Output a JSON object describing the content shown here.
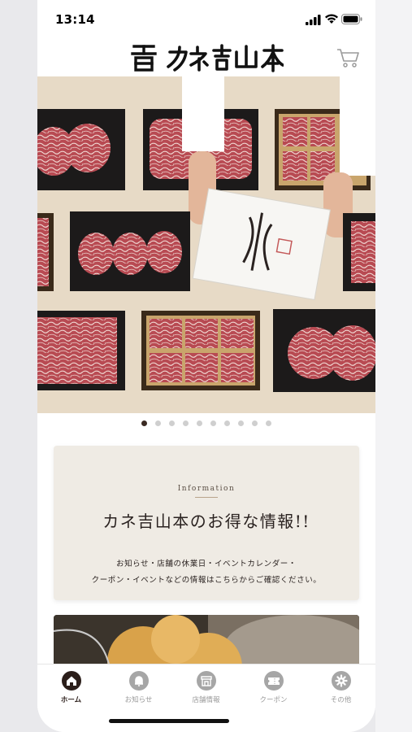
{
  "status_bar": {
    "time": "13:14"
  },
  "header": {
    "logo_text": "カネ吉山本",
    "cart_icon": "cart-icon"
  },
  "carousel": {
    "slide_count": 10,
    "active_index": 0
  },
  "info_card": {
    "label": "Information",
    "title": "カネ吉山本のお得な情報!!",
    "line1": "お知らせ・店舗の休業日・イベントカレンダー・",
    "line2": "クーポン・イベントなどの情報はこちらからご確認ください。"
  },
  "tabs": [
    {
      "label": "ホーム",
      "icon": "home-icon",
      "active": true
    },
    {
      "label": "お知らせ",
      "icon": "bell-icon",
      "active": false
    },
    {
      "label": "店舗情報",
      "icon": "store-icon",
      "active": false
    },
    {
      "label": "クーポン",
      "icon": "coupon-icon",
      "active": false
    },
    {
      "label": "その他",
      "icon": "gear-icon",
      "active": false
    }
  ],
  "colors": {
    "accent": "#2b1e1a",
    "card_bg": "#efebe4",
    "inactive_tab": "#9a9a9a"
  }
}
